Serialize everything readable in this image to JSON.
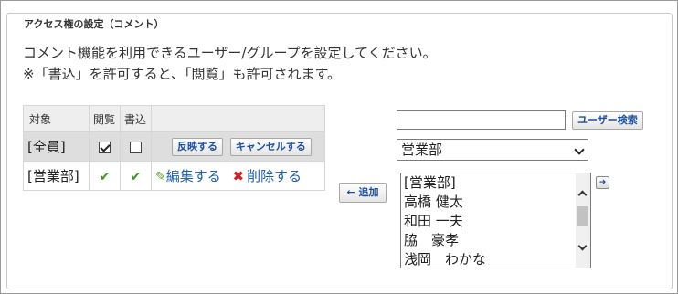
{
  "legend": "アクセス権の設定（コメント）",
  "description": {
    "line1": "コメント機能を利用できるユーザー/グループを設定してください。",
    "line2": "※「書込」を許可すると、「閲覧」も許可されます。"
  },
  "table": {
    "headers": {
      "target": "対象",
      "view": "閲覧",
      "write": "書込"
    },
    "rows": [
      {
        "target": "[全員]",
        "view_checked": true,
        "write_checked": false,
        "apply_label": "反映する",
        "cancel_label": "キャンセルする"
      },
      {
        "target": "[営業部]",
        "view": "✔",
        "write": "✔",
        "edit_label": "編集する",
        "delete_label": "削除する"
      }
    ]
  },
  "add_button_label": "← 追加",
  "search": {
    "value": "",
    "button_label": "ユーザー検索"
  },
  "group_select": {
    "selected": "営業部"
  },
  "member_list": [
    "[営業部]",
    "高橋 健太",
    "和田 一夫",
    "脇　豪孝",
    "浅岡　わかな"
  ],
  "icons": {
    "pencil": "pencil-icon",
    "delete": "x-icon",
    "check": "check-icon",
    "add_member": "arrow-right-icon"
  },
  "colors": {
    "link": "#1f5fb4",
    "check_green": "#3a9a1e",
    "delete_red": "#d32020",
    "button_text": "#1a4fa0"
  }
}
